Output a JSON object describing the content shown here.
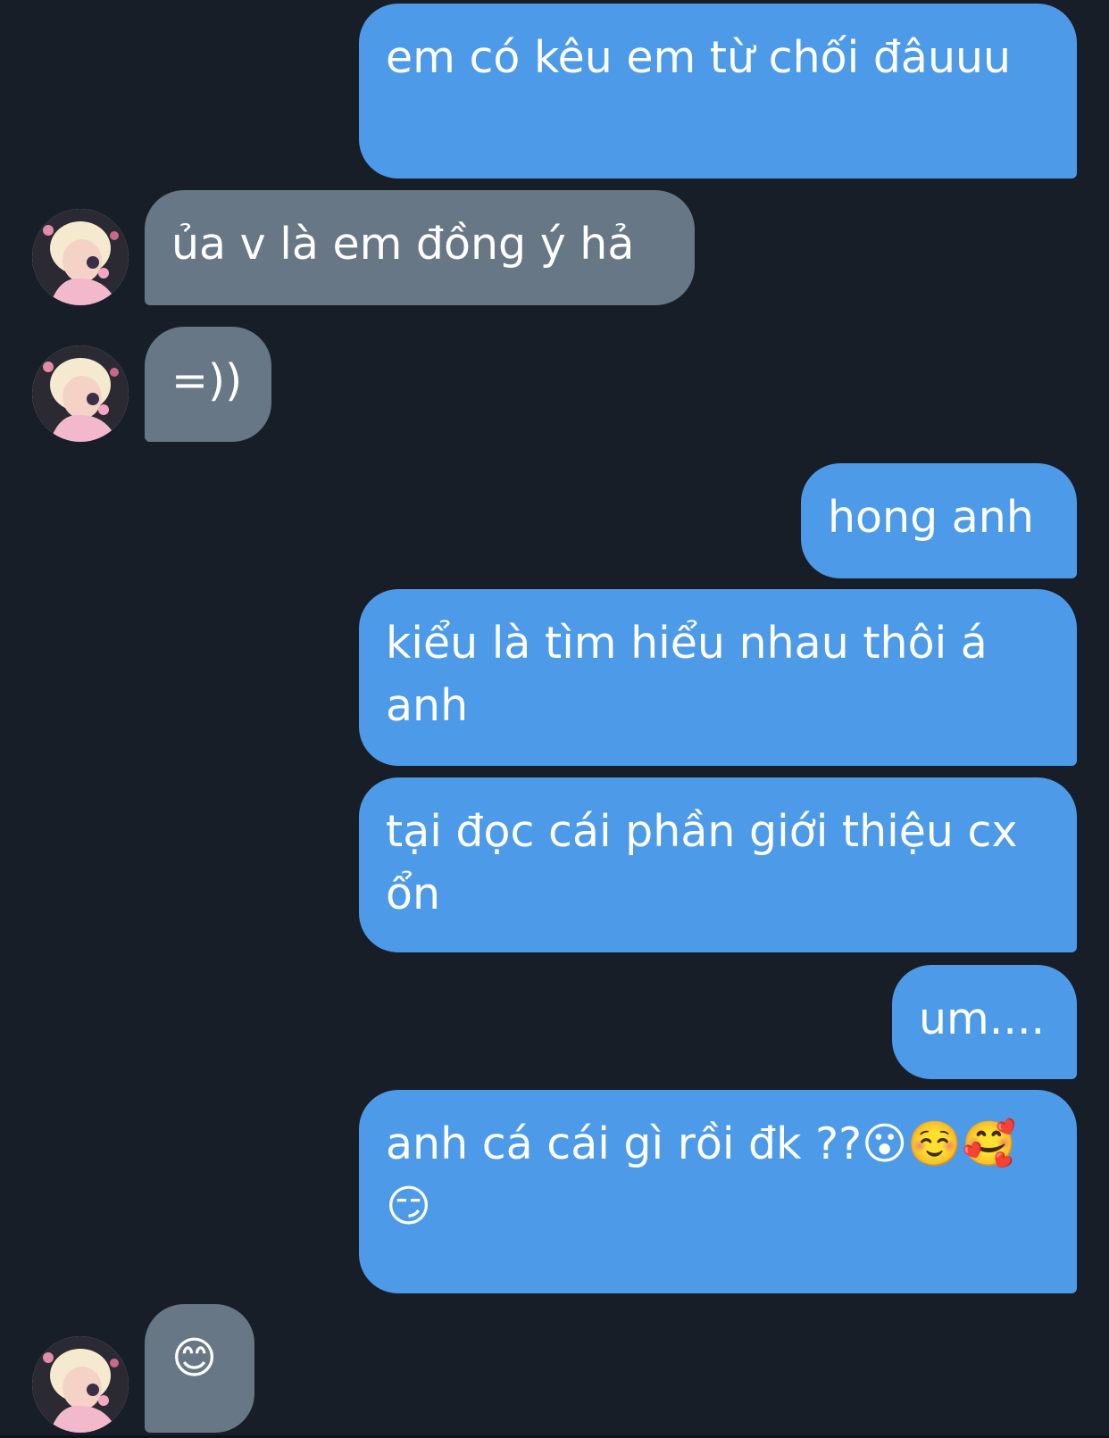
{
  "conversation": {
    "messages": [
      {
        "sender": "me",
        "text": "em có kêu em từ chối đâuuu"
      },
      {
        "sender": "them",
        "text": "ủa v là em đồng ý hả"
      },
      {
        "sender": "them",
        "text": "=))"
      },
      {
        "sender": "me",
        "text": "hong anh"
      },
      {
        "sender": "me",
        "text": "kiểu là tìm hiểu nhau thôi á anh"
      },
      {
        "sender": "me",
        "text": "tại đọc cái phần giới thiệu cx ổn"
      },
      {
        "sender": "me",
        "text": "um...."
      },
      {
        "sender": "me",
        "text": "anh cá cái gì rồi đk ??😮☺️🥰😏"
      },
      {
        "sender": "them",
        "text": "😊"
      }
    ]
  },
  "colors": {
    "background": "#171e28",
    "sent_bubble": "#4d9be8",
    "received_bubble": "#687785",
    "text": "#ffffff"
  },
  "icons": {
    "avatar": "contact-avatar-photo"
  }
}
